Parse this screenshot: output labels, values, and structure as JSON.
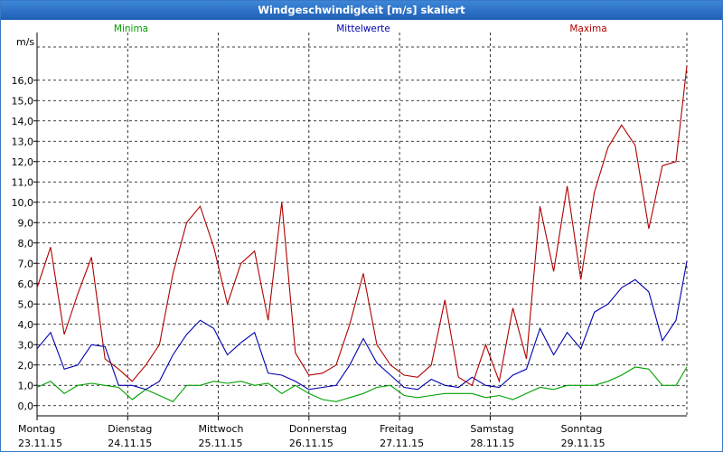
{
  "window": {
    "title": "Windgeschwindigkeit [m/s] skaliert"
  },
  "chart_data": {
    "type": "line",
    "title": "Windgeschwindigkeit [m/s] skaliert",
    "ylabel": "m/s",
    "ylim": [
      -0.5,
      17.5
    ],
    "yticks": [
      "0,0",
      "1,0",
      "2,0",
      "3,0",
      "4,0",
      "5,0",
      "6,0",
      "7,0",
      "8,0",
      "9,0",
      "10,0",
      "11,0",
      "12,0",
      "13,0",
      "14,0",
      "15,0",
      "16,0"
    ],
    "xlim": [
      0,
      7.17
    ],
    "day_labels": [
      {
        "day": "Montag",
        "date": "23.11.15"
      },
      {
        "day": "Dienstag",
        "date": "24.11.15"
      },
      {
        "day": "Mittwoch",
        "date": "25.11.15"
      },
      {
        "day": "Donnerstag",
        "date": "26.11.15"
      },
      {
        "day": "Freitag",
        "date": "27.11.15"
      },
      {
        "day": "Samstag",
        "date": "28.11.15"
      },
      {
        "day": "Sonntag",
        "date": "29.11.15"
      }
    ],
    "grid": true,
    "legend_position": "top",
    "colors": {
      "Minima": "#00a000",
      "Mittelwerte": "#0000b0",
      "Maxima": "#b00000"
    },
    "series": [
      {
        "name": "Minima",
        "x": [
          0,
          0.15,
          0.3,
          0.45,
          0.6,
          0.75,
          0.9,
          1.05,
          1.2,
          1.35,
          1.5,
          1.65,
          1.8,
          1.95,
          2.1,
          2.25,
          2.4,
          2.55,
          2.7,
          2.85,
          3.0,
          3.15,
          3.3,
          3.45,
          3.6,
          3.75,
          3.9,
          4.05,
          4.2,
          4.35,
          4.5,
          4.65,
          4.8,
          4.95,
          5.1,
          5.25,
          5.4,
          5.55,
          5.7,
          5.85,
          6.0,
          6.15,
          6.3,
          6.45,
          6.6,
          6.75,
          6.9,
          7.05,
          7.17
        ],
        "y": [
          0.9,
          1.2,
          0.6,
          1.0,
          1.1,
          1.0,
          0.9,
          0.3,
          0.8,
          0.5,
          0.2,
          1.0,
          1.0,
          1.2,
          1.1,
          1.2,
          1.0,
          1.1,
          0.6,
          1.0,
          0.6,
          0.3,
          0.2,
          0.4,
          0.6,
          0.9,
          1.0,
          0.5,
          0.4,
          0.5,
          0.6,
          0.6,
          0.6,
          0.4,
          0.5,
          0.3,
          0.6,
          0.9,
          0.8,
          1.0,
          1.0,
          1.0,
          1.2,
          1.5,
          1.9,
          1.8,
          1.0,
          1.0,
          1.9
        ]
      },
      {
        "name": "Mittelwerte",
        "x": [
          0,
          0.15,
          0.3,
          0.45,
          0.6,
          0.75,
          0.9,
          1.05,
          1.2,
          1.35,
          1.5,
          1.65,
          1.8,
          1.95,
          2.1,
          2.25,
          2.4,
          2.55,
          2.7,
          2.85,
          3.0,
          3.15,
          3.3,
          3.45,
          3.6,
          3.75,
          3.9,
          4.05,
          4.2,
          4.35,
          4.5,
          4.65,
          4.8,
          4.95,
          5.1,
          5.25,
          5.4,
          5.55,
          5.7,
          5.85,
          6.0,
          6.15,
          6.3,
          6.45,
          6.6,
          6.75,
          6.9,
          7.05,
          7.17
        ],
        "y": [
          2.8,
          3.6,
          1.8,
          2.0,
          3.0,
          2.9,
          1.0,
          1.0,
          0.8,
          1.2,
          2.5,
          3.5,
          4.2,
          3.8,
          2.5,
          3.1,
          3.6,
          1.6,
          1.5,
          1.2,
          0.8,
          0.9,
          1.0,
          2.0,
          3.3,
          2.1,
          1.5,
          0.9,
          0.8,
          1.3,
          1.0,
          0.9,
          1.4,
          1.0,
          0.9,
          1.5,
          1.8,
          3.8,
          2.5,
          3.6,
          2.8,
          4.6,
          5.0,
          5.8,
          6.2,
          5.6,
          3.2,
          4.2,
          7.1
        ]
      },
      {
        "name": "Maxima",
        "x": [
          0,
          0.15,
          0.3,
          0.45,
          0.6,
          0.75,
          0.9,
          1.05,
          1.2,
          1.35,
          1.5,
          1.65,
          1.8,
          1.95,
          2.1,
          2.25,
          2.4,
          2.55,
          2.7,
          2.85,
          3.0,
          3.15,
          3.3,
          3.45,
          3.6,
          3.75,
          3.9,
          4.05,
          4.2,
          4.35,
          4.5,
          4.65,
          4.8,
          4.95,
          5.1,
          5.25,
          5.4,
          5.55,
          5.7,
          5.85,
          6.0,
          6.15,
          6.3,
          6.45,
          6.6,
          6.75,
          6.9,
          7.05,
          7.17
        ],
        "y": [
          5.8,
          7.8,
          3.5,
          5.5,
          7.3,
          2.3,
          1.8,
          1.2,
          2.0,
          3.0,
          6.5,
          9.0,
          9.8,
          7.8,
          5.0,
          7.0,
          7.6,
          4.2,
          10.0,
          2.6,
          1.5,
          1.6,
          2.0,
          4.0,
          6.5,
          3.0,
          2.0,
          1.5,
          1.4,
          2.0,
          5.2,
          1.4,
          1.0,
          3.0,
          1.2,
          4.8,
          2.3,
          9.8,
          6.6,
          10.8,
          6.2,
          10.5,
          12.7,
          13.8,
          12.8,
          8.7,
          11.8,
          12.0,
          16.7
        ]
      }
    ]
  }
}
